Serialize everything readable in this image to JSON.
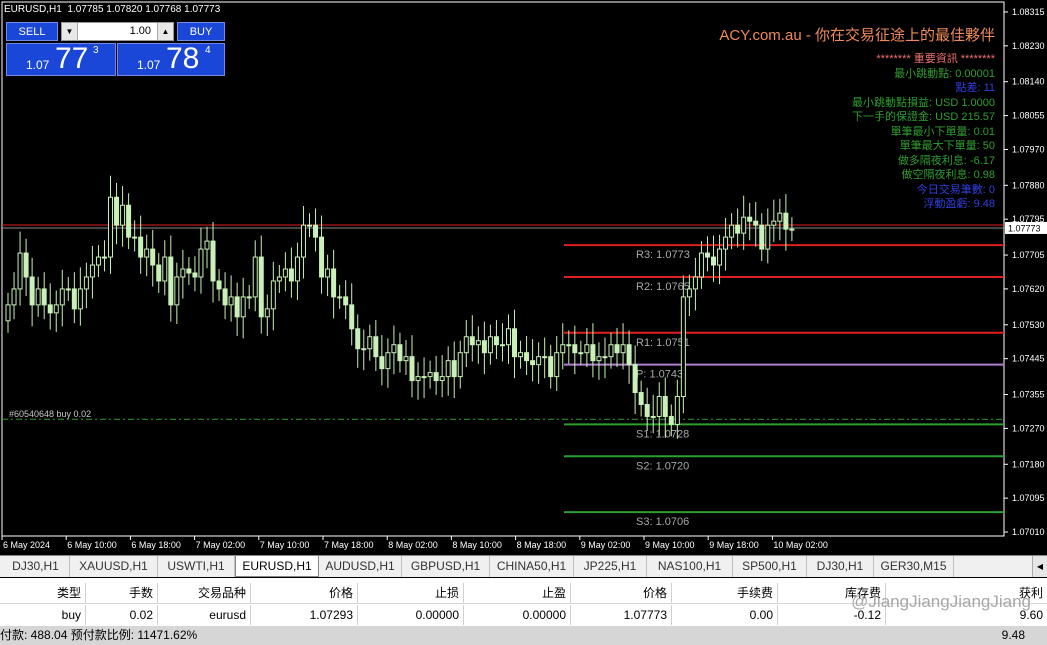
{
  "header": {
    "symbol": "EURUSD,H1",
    "ohlc": "1.07785 1.07820 1.07768 1.07773"
  },
  "trade_panel": {
    "sell_label": "SELL",
    "buy_label": "BUY",
    "lot_value": "1.00",
    "sell_prefix": "1.07",
    "sell_big": "77",
    "sell_sup": "3",
    "buy_prefix": "1.07",
    "buy_big": "78",
    "buy_sup": "4"
  },
  "brand_title": "ACY.com.au - 你在交易征途上的最佳夥伴",
  "info_lines": [
    {
      "text": "******** 重要資訊 ********",
      "color": "#f07070"
    },
    {
      "text": "最小跳動點: 0.00001",
      "color": "#2e9e2e"
    },
    {
      "text": "點差: 11",
      "color": "#2f3fe0"
    },
    {
      "text": "最小跳動點損益: USD 1.0000",
      "color": "#2e9e2e"
    },
    {
      "text": "下一手的保證金: USD 215.57",
      "color": "#2e9e2e"
    },
    {
      "text": "單筆最小下單量: 0.01",
      "color": "#2e9e2e"
    },
    {
      "text": "單筆最大下單量: 50",
      "color": "#2e9e2e"
    },
    {
      "text": "做多隔夜利息: -6.17",
      "color": "#2e9e2e"
    },
    {
      "text": "做空隔夜利息: 0.98",
      "color": "#2e9e2e"
    },
    {
      "text": "今日交易筆數: 0",
      "color": "#2f3fe0"
    },
    {
      "text": "浮動盈虧: 9.48",
      "color": "#2f3fe0"
    }
  ],
  "order_label": "#60540648 buy 0.02",
  "chart_data": {
    "type": "candlestick",
    "symbol": "EURUSD",
    "timeframe": "H1",
    "ylim": [
      1.07,
      1.0834
    ],
    "y_ticks": [
      "1.08315",
      "1.08230",
      "1.08140",
      "1.08055",
      "1.07970",
      "1.07880",
      "1.07795",
      "1.07705",
      "1.07620",
      "1.07530",
      "1.07445",
      "1.07355",
      "1.07270",
      "1.07180",
      "1.07095",
      "1.07010"
    ],
    "x_ticks": [
      "6 May 2024",
      "6 May 10:00",
      "6 May 18:00",
      "7 May 02:00",
      "7 May 10:00",
      "7 May 18:00",
      "8 May 02:00",
      "8 May 10:00",
      "8 May 18:00",
      "9 May 02:00",
      "9 May 10:00",
      "9 May 18:00",
      "10 May 02:00"
    ],
    "current_price": "1.07773",
    "order_price": 1.07293,
    "pivot_levels": [
      {
        "label": "R3: 1.0773",
        "value": 1.0773,
        "color": "#e02020"
      },
      {
        "label": "R2: 1.0765",
        "value": 1.0765,
        "color": "#e02020"
      },
      {
        "label": "R1: 1.0751",
        "value": 1.0751,
        "color": "#e02020"
      },
      {
        "label": "P: 1.0743",
        "value": 1.0743,
        "color": "#b080d0"
      },
      {
        "label": "S1: 1.0728",
        "value": 1.0728,
        "color": "#2e9e2e"
      },
      {
        "label": "S2: 1.0720",
        "value": 1.072,
        "color": "#2e9e2e"
      },
      {
        "label": "S3: 1.0706",
        "value": 1.0706,
        "color": "#2e9e2e"
      }
    ],
    "closes": [
      1.0758,
      1.0762,
      1.0771,
      1.0765,
      1.0758,
      1.0762,
      1.0758,
      1.0756,
      1.0758,
      1.0762,
      1.0762,
      1.0757,
      1.0762,
      1.0765,
      1.0768,
      1.077,
      1.077,
      1.0785,
      1.0778,
      1.0783,
      1.0775,
      1.0775,
      1.077,
      1.0772,
      1.0768,
      1.0764,
      1.077,
      1.0758,
      1.0765,
      1.0767,
      1.0766,
      1.0765,
      1.0772,
      1.0774,
      1.0764,
      1.0762,
      1.0758,
      1.076,
      1.0755,
      1.076,
      1.076,
      1.077,
      1.0755,
      1.0757,
      1.0764,
      1.0765,
      1.0767,
      1.0764,
      1.077,
      1.0778,
      1.0778,
      1.0775,
      1.0765,
      1.0767,
      1.076,
      1.076,
      1.0758,
      1.0752,
      1.0747,
      1.0747,
      1.075,
      1.0745,
      1.0742,
      1.0746,
      1.0748,
      1.0744,
      1.0745,
      1.0739,
      1.074,
      1.074,
      1.0741,
      1.0739,
      1.074,
      1.0744,
      1.074,
      1.0746,
      1.075,
      1.0748,
      1.0749,
      1.0746,
      1.075,
      1.0748,
      1.0748,
      1.0752,
      1.0745,
      1.0746,
      1.0744,
      1.0743,
      1.0745,
      1.0745,
      1.074,
      1.0746,
      1.0748,
      1.0748,
      1.0746,
      1.0746,
      1.0748,
      1.0744,
      1.0745,
      1.0745,
      1.0748,
      1.0746,
      1.0748,
      1.0743,
      1.0736,
      1.0733,
      1.073,
      1.073,
      1.0735,
      1.073,
      1.0728,
      1.0735,
      1.076,
      1.0762,
      1.0765,
      1.0771,
      1.077,
      1.0768,
      1.0772,
      1.0775,
      1.0778,
      1.0776,
      1.078,
      1.0779,
      1.0778,
      1.0772,
      1.0778,
      1.0779,
      1.0781,
      1.0777,
      1.0777
    ]
  },
  "tabs": [
    {
      "label": "DJ30,H1"
    },
    {
      "label": "XAUUSD,H1"
    },
    {
      "label": "USWTI,H1"
    },
    {
      "label": "EURUSD,H1",
      "active": true
    },
    {
      "label": "AUDUSD,H1"
    },
    {
      "label": "GBPUSD,H1"
    },
    {
      "label": "CHINA50,H1"
    },
    {
      "label": "JP225,H1"
    },
    {
      "label": "NAS100,H1"
    },
    {
      "label": "SP500,H1"
    },
    {
      "label": "DJ30,H1"
    },
    {
      "label": "GER30,M15"
    }
  ],
  "terminal": {
    "headers": [
      "类型",
      "手数",
      "交易品种",
      "价格",
      "止损",
      "止盈",
      "价格",
      "手续费",
      "库存费",
      "获利"
    ],
    "row": [
      "buy",
      "0.02",
      "eurusd",
      "1.07293",
      "0.00000",
      "0.00000",
      "1.07773",
      "0.00",
      "-0.12",
      "9.60"
    ],
    "summary_left": "付款: 488.04  预付款比例: 11471.62%",
    "summary_right": "9.48",
    "watermark": "@JiangJiangJiangJiang"
  },
  "colors": {
    "candle": "#c8f0b8",
    "price_line": "#e02020",
    "order_line": "#2e9e2e",
    "panel_blue": "#1a47d8"
  }
}
